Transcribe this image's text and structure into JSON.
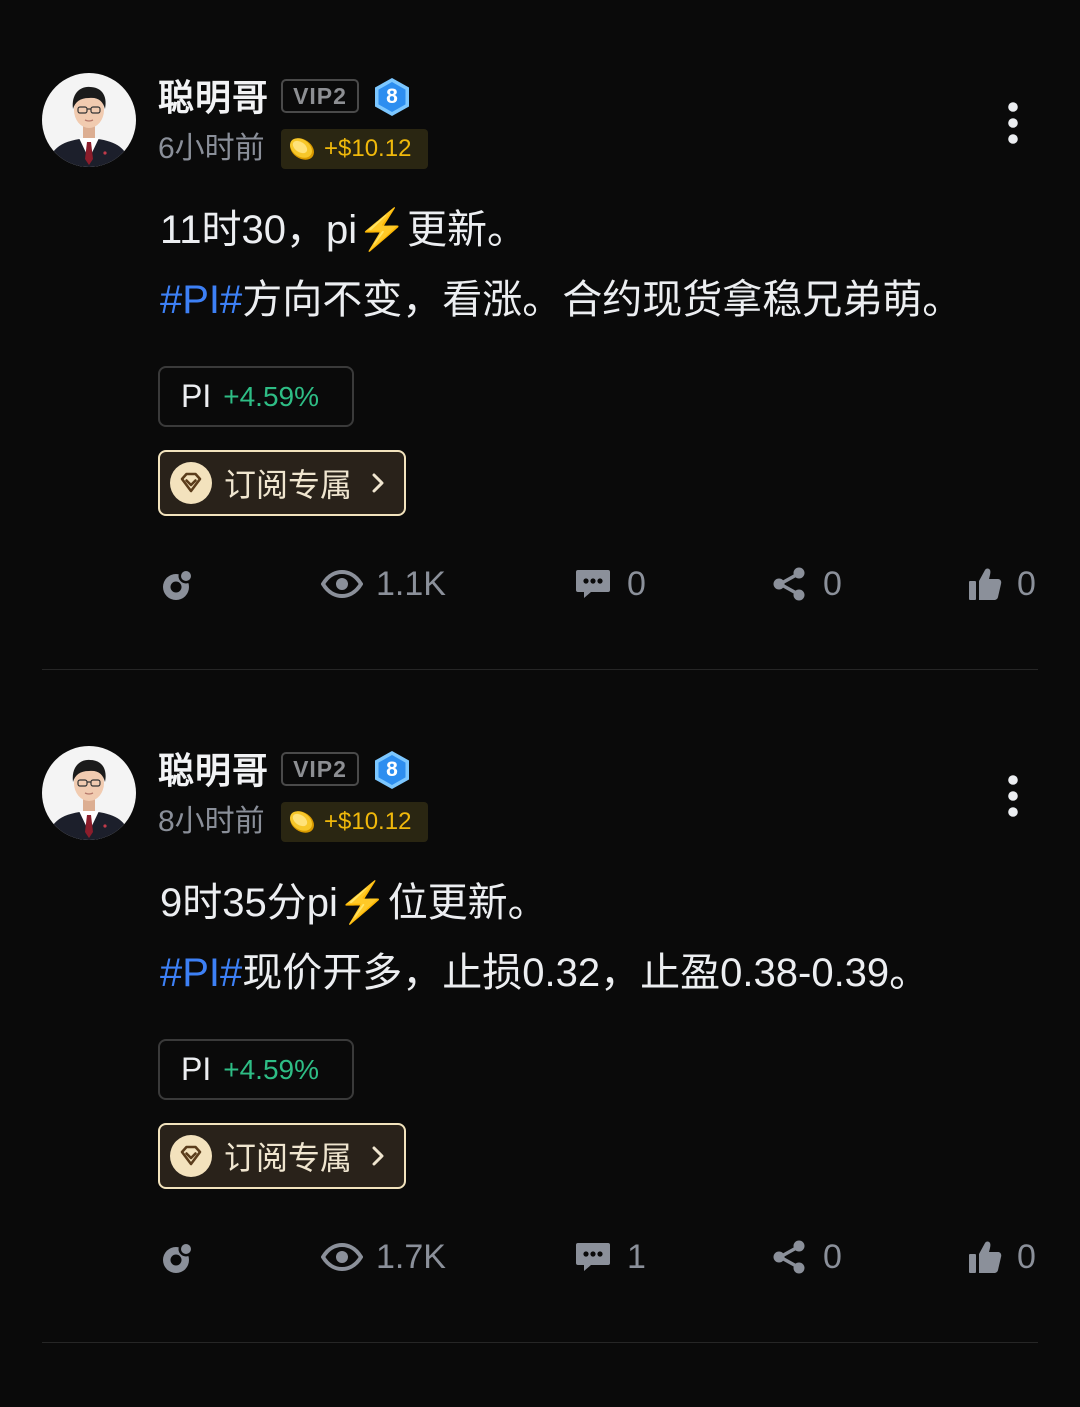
{
  "colors": {
    "background": "#0a0a0a",
    "text": "#eceef1",
    "muted": "#8a8f99",
    "hashtag": "#3d80f5",
    "positive_change": "#2ebd85",
    "tip_gold": "#f0b90b",
    "subscribe_border": "#f2e3bd",
    "level_badge": "#2d8ef0"
  },
  "icons": {
    "menu": "more-vertical-icon",
    "level": "hexagon-level-icon",
    "tip": "coin-icon",
    "subscribe": "diamond-icon",
    "subscribe_arrow": "chevron-right-icon",
    "repost": "repost-icon",
    "views": "eye-icon",
    "comments": "comment-icon",
    "share": "share-icon",
    "like": "thumbs-up-icon"
  },
  "posts": [
    {
      "author": {
        "name": "聪明哥",
        "vip": "VIP2",
        "level": "8"
      },
      "time": "6小时前",
      "tip": "+$10.12",
      "text_line1": {
        "before": "11时30，pi",
        "emoji": "⚡",
        "after": "更新。"
      },
      "text_line2": {
        "hashtag": "#PI#",
        "text": "方向不变，看涨。合约现货拿稳兄弟萌。"
      },
      "coin_chip": {
        "symbol": "PI",
        "change": "+4.59%"
      },
      "subscribe_label": "订阅专属",
      "stats": {
        "views": "1.1K",
        "comments": "0",
        "shares": "0",
        "likes": "0"
      }
    },
    {
      "author": {
        "name": "聪明哥",
        "vip": "VIP2",
        "level": "8"
      },
      "time": "8小时前",
      "tip": "+$10.12",
      "text_line1": {
        "before": "9时35分pi",
        "emoji": "⚡",
        "after": "位更新。"
      },
      "text_line2": {
        "hashtag": "#PI#",
        "text": "现价开多，止损0.32，止盈0.38-0.39。"
      },
      "coin_chip": {
        "symbol": "PI",
        "change": "+4.59%"
      },
      "subscribe_label": "订阅专属",
      "stats": {
        "views": "1.7K",
        "comments": "1",
        "shares": "0",
        "likes": "0"
      }
    }
  ]
}
